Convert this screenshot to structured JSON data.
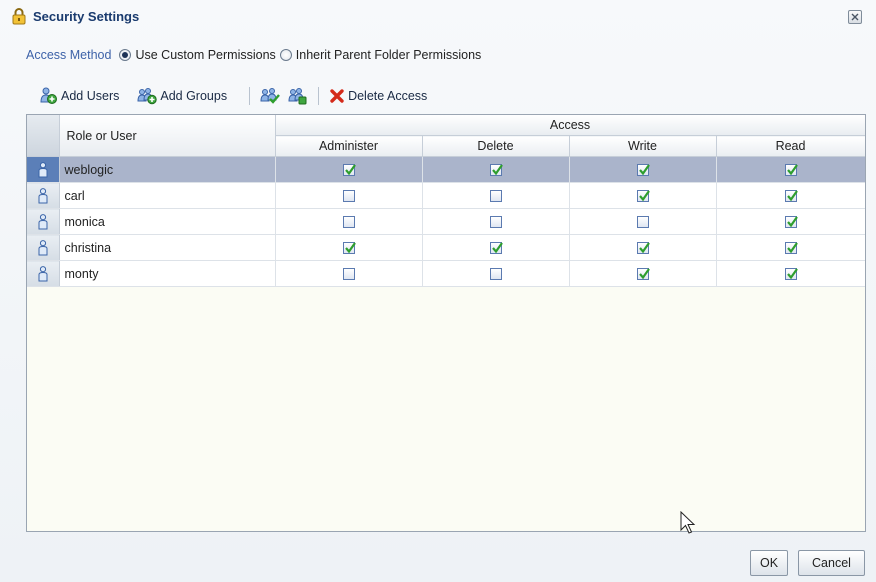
{
  "dialog": {
    "title": "Security Settings",
    "icon": "lock-icon"
  },
  "access": {
    "label": "Access Method",
    "options": [
      {
        "label": "Use Custom Permissions",
        "selected": true
      },
      {
        "label": "Inherit Parent Folder Permissions",
        "selected": false
      }
    ]
  },
  "toolbar": {
    "add_users": "Add Users",
    "add_groups": "Add Groups",
    "delete_access": "Delete Access"
  },
  "table": {
    "role_header": "Role or User",
    "group_header": "Access",
    "columns": [
      "Administer",
      "Delete",
      "Write",
      "Read"
    ],
    "rows": [
      {
        "name": "weblogic",
        "selected": true,
        "checks": [
          true,
          true,
          true,
          true
        ]
      },
      {
        "name": "carl",
        "selected": false,
        "checks": [
          false,
          false,
          true,
          true
        ]
      },
      {
        "name": "monica",
        "selected": false,
        "checks": [
          false,
          false,
          false,
          true
        ]
      },
      {
        "name": "christina",
        "selected": false,
        "checks": [
          true,
          true,
          true,
          true
        ]
      },
      {
        "name": "monty",
        "selected": false,
        "checks": [
          false,
          false,
          true,
          true
        ]
      }
    ]
  },
  "buttons": {
    "ok": "OK",
    "cancel": "Cancel"
  },
  "colors": {
    "title": "#1a3b6e",
    "access_label": "#3d62a8",
    "selected_row": "#aab4cb",
    "check_green": "#2e9e2e",
    "delete_red": "#d42a1a"
  }
}
